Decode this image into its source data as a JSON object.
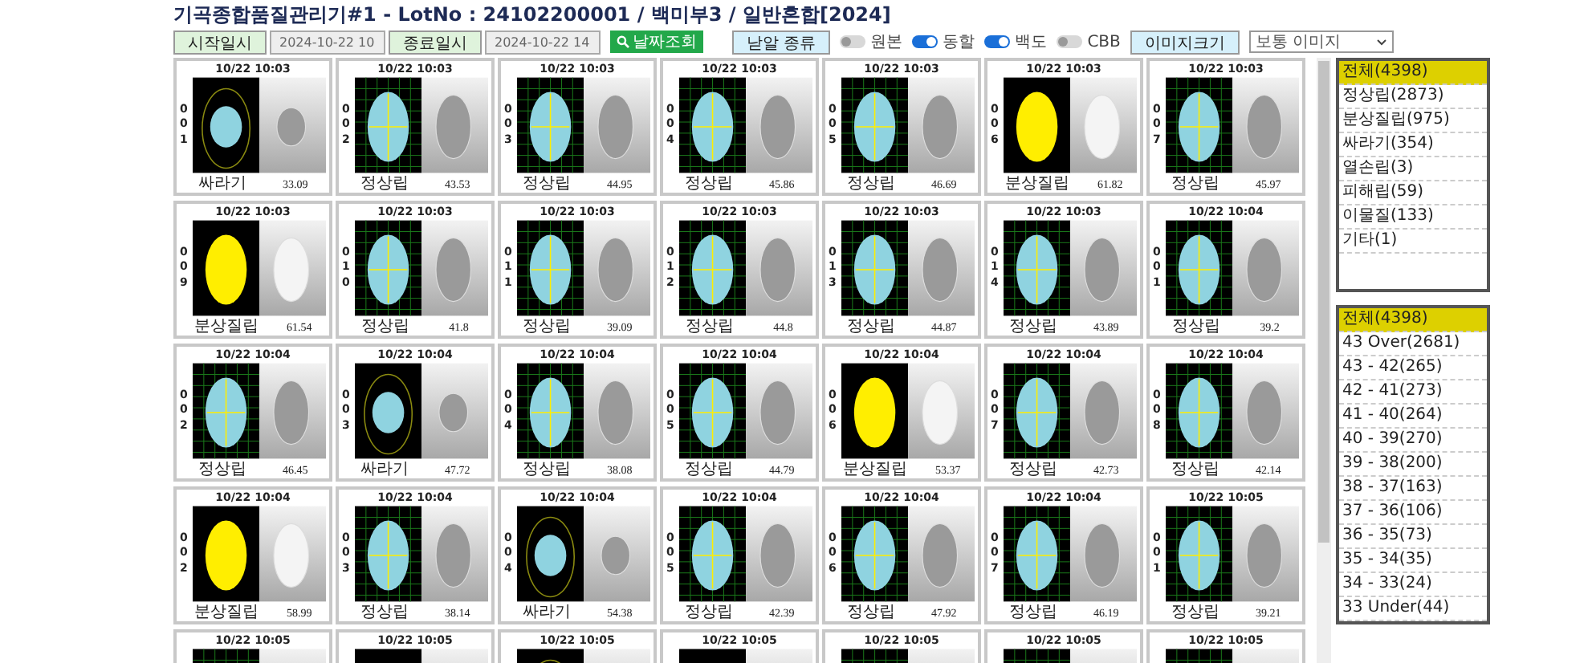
{
  "title": "기곡종합품질관리기#1 - LotNo : 24102200001 / 백미부3 / 일반혼합[2024]",
  "filters": {
    "start_label": "시작일시",
    "start_value": "2024-10-22 10",
    "end_label": "종료일시",
    "end_value": "2024-10-22 14",
    "search_button": "날짜조회",
    "grain_label": "낟알 종류",
    "toggles": [
      {
        "label": "원본",
        "on": false
      },
      {
        "label": "동할",
        "on": true
      },
      {
        "label": "백도",
        "on": true
      },
      {
        "label": "CBB",
        "on": false
      }
    ],
    "size_label": "이미지크기",
    "size_value": "보통 이미지"
  },
  "cards": [
    {
      "time": "10/22 10:03",
      "code": "001",
      "label": "싸라기",
      "value": "33.09",
      "kind": "broken"
    },
    {
      "time": "10/22 10:03",
      "code": "002",
      "label": "정상립",
      "value": "43.53",
      "kind": "normal"
    },
    {
      "time": "10/22 10:03",
      "code": "003",
      "label": "정상립",
      "value": "44.95",
      "kind": "normal"
    },
    {
      "time": "10/22 10:03",
      "code": "004",
      "label": "정상립",
      "value": "45.86",
      "kind": "normal"
    },
    {
      "time": "10/22 10:03",
      "code": "005",
      "label": "정상립",
      "value": "46.69",
      "kind": "normal"
    },
    {
      "time": "10/22 10:03",
      "code": "006",
      "label": "분상질립",
      "value": "61.82",
      "kind": "chalky"
    },
    {
      "time": "10/22 10:03",
      "code": "007",
      "label": "정상립",
      "value": "45.97",
      "kind": "normal"
    },
    {
      "time": "10/22 10:03",
      "code": "009",
      "label": "분상질립",
      "value": "61.54",
      "kind": "chalky"
    },
    {
      "time": "10/22 10:03",
      "code": "010",
      "label": "정상립",
      "value": "41.8",
      "kind": "normal"
    },
    {
      "time": "10/22 10:03",
      "code": "011",
      "label": "정상립",
      "value": "39.09",
      "kind": "normal"
    },
    {
      "time": "10/22 10:03",
      "code": "012",
      "label": "정상립",
      "value": "44.8",
      "kind": "normal"
    },
    {
      "time": "10/22 10:03",
      "code": "013",
      "label": "정상립",
      "value": "44.87",
      "kind": "normal"
    },
    {
      "time": "10/22 10:03",
      "code": "014",
      "label": "정상립",
      "value": "43.89",
      "kind": "normal"
    },
    {
      "time": "10/22 10:04",
      "code": "001",
      "label": "정상립",
      "value": "39.2",
      "kind": "normal"
    },
    {
      "time": "10/22 10:04",
      "code": "002",
      "label": "정상립",
      "value": "46.45",
      "kind": "normal"
    },
    {
      "time": "10/22 10:04",
      "code": "003",
      "label": "싸라기",
      "value": "47.72",
      "kind": "broken"
    },
    {
      "time": "10/22 10:04",
      "code": "004",
      "label": "정상립",
      "value": "38.08",
      "kind": "normal"
    },
    {
      "time": "10/22 10:04",
      "code": "005",
      "label": "정상립",
      "value": "44.79",
      "kind": "normal"
    },
    {
      "time": "10/22 10:04",
      "code": "006",
      "label": "분상질립",
      "value": "53.37",
      "kind": "chalky"
    },
    {
      "time": "10/22 10:04",
      "code": "007",
      "label": "정상립",
      "value": "42.73",
      "kind": "normal"
    },
    {
      "time": "10/22 10:04",
      "code": "008",
      "label": "정상립",
      "value": "42.14",
      "kind": "normal"
    },
    {
      "time": "10/22 10:04",
      "code": "002",
      "label": "분상질립",
      "value": "58.99",
      "kind": "chalky"
    },
    {
      "time": "10/22 10:04",
      "code": "003",
      "label": "정상립",
      "value": "38.14",
      "kind": "normal"
    },
    {
      "time": "10/22 10:04",
      "code": "004",
      "label": "싸라기",
      "value": "54.38",
      "kind": "broken"
    },
    {
      "time": "10/22 10:04",
      "code": "005",
      "label": "정상립",
      "value": "42.39",
      "kind": "normal"
    },
    {
      "time": "10/22 10:04",
      "code": "006",
      "label": "정상립",
      "value": "47.92",
      "kind": "normal"
    },
    {
      "time": "10/22 10:04",
      "code": "007",
      "label": "정상립",
      "value": "46.19",
      "kind": "normal"
    },
    {
      "time": "10/22 10:05",
      "code": "001",
      "label": "정상립",
      "value": "39.21",
      "kind": "normal"
    },
    {
      "time": "10/22 10:05",
      "kind": "normal"
    },
    {
      "time": "10/22 10:05",
      "kind": "chalky"
    },
    {
      "time": "10/22 10:05",
      "kind": "broken"
    },
    {
      "time": "10/22 10:05",
      "kind": "chalky"
    },
    {
      "time": "10/22 10:05",
      "kind": "normal"
    },
    {
      "time": "10/22 10:05",
      "kind": "normal"
    },
    {
      "time": "10/22 10:05",
      "kind": "normal"
    }
  ],
  "type_list": [
    {
      "label": "전체(4398)",
      "selected": true
    },
    {
      "label": "정상립(2873)",
      "selected": false
    },
    {
      "label": "분상질립(975)",
      "selected": false
    },
    {
      "label": "싸라기(354)",
      "selected": false
    },
    {
      "label": "열손립(3)",
      "selected": false
    },
    {
      "label": "피해립(59)",
      "selected": false
    },
    {
      "label": "이물질(133)",
      "selected": false
    },
    {
      "label": "기타(1)",
      "selected": false
    }
  ],
  "size_list": [
    {
      "label": "전체(4398)",
      "selected": true
    },
    {
      "label": "43 Over(2681)",
      "selected": false
    },
    {
      "label": "43 - 42(265)",
      "selected": false
    },
    {
      "label": "42 - 41(273)",
      "selected": false
    },
    {
      "label": "41 - 40(264)",
      "selected": false
    },
    {
      "label": "40 - 39(270)",
      "selected": false
    },
    {
      "label": "39 - 38(200)",
      "selected": false
    },
    {
      "label": "38 - 37(163)",
      "selected": false
    },
    {
      "label": "37 - 36(106)",
      "selected": false
    },
    {
      "label": "36 - 35(73)",
      "selected": false
    },
    {
      "label": "35 - 34(35)",
      "selected": false
    },
    {
      "label": "34 - 33(24)",
      "selected": false
    },
    {
      "label": "33 Under(44)",
      "selected": false
    }
  ]
}
